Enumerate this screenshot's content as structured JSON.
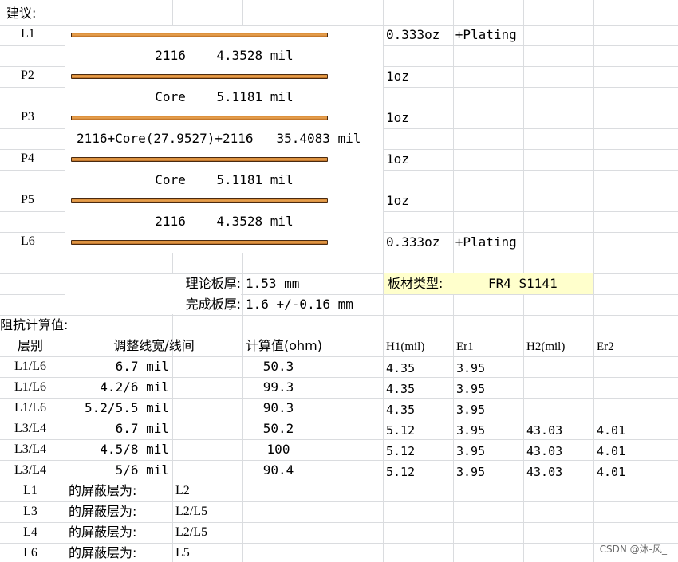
{
  "advice_title": "建议:",
  "stackup": [
    {
      "layer": "L1",
      "copper": "0.333oz  +Plating"
    },
    {
      "layer": "P2",
      "copper": "1oz"
    },
    {
      "layer": "P3",
      "copper": "1oz"
    },
    {
      "layer": "P4",
      "copper": "1oz"
    },
    {
      "layer": "P5",
      "copper": "1oz"
    },
    {
      "layer": "L6",
      "copper": "0.333oz  +Plating"
    }
  ],
  "dielectrics": [
    "2116    4.3528 mil",
    "Core    5.1181 mil",
    "2116+Core(27.9527)+2116   35.4083 mil",
    "Core    5.1181 mil",
    "2116    4.3528 mil"
  ],
  "thickness": {
    "theory_label": "理论板厚:",
    "theory_value": "1.53 mm",
    "finish_label": "完成板厚:",
    "finish_value": "1.6 +/-0.16 mm",
    "material_label": "板材类型:",
    "material_value": "FR4 S1141"
  },
  "impedance": {
    "title": "阻抗计算值:",
    "headers": {
      "layer": "层别",
      "width": "调整线宽/线间",
      "calc": "计算值(ohm)",
      "h1": "H1(mil)",
      "er1": "Er1",
      "h2": "H2(mil)",
      "er2": "Er2"
    },
    "rows": [
      {
        "layer": "L1/L6",
        "width": "6.7 mil",
        "calc": "50.3",
        "h1": "4.35",
        "er1": "3.95",
        "h2": "",
        "er2": ""
      },
      {
        "layer": "L1/L6",
        "width": "4.2/6 mil",
        "calc": "99.3",
        "h1": "4.35",
        "er1": "3.95",
        "h2": "",
        "er2": ""
      },
      {
        "layer": "L1/L6",
        "width": "5.2/5.5 mil",
        "calc": "90.3",
        "h1": "4.35",
        "er1": "3.95",
        "h2": "",
        "er2": ""
      },
      {
        "layer": "L3/L4",
        "width": "6.7 mil",
        "calc": "50.2",
        "h1": "5.12",
        "er1": "3.95",
        "h2": "43.03",
        "er2": "4.01"
      },
      {
        "layer": "L3/L4",
        "width": "4.5/8 mil",
        "calc": "100",
        "h1": "5.12",
        "er1": "3.95",
        "h2": "43.03",
        "er2": "4.01"
      },
      {
        "layer": "L3/L4",
        "width": "5/6 mil",
        "calc": "90.4",
        "h1": "5.12",
        "er1": "3.95",
        "h2": "43.03",
        "er2": "4.01"
      }
    ]
  },
  "shielding": [
    {
      "layer": "L1",
      "label": "的屏蔽层为:",
      "ref": "L2"
    },
    {
      "layer": "L3",
      "label": "的屏蔽层为:",
      "ref": "L2/L5"
    },
    {
      "layer": "L4",
      "label": "的屏蔽层为:",
      "ref": "L2/L5"
    },
    {
      "layer": "L6",
      "label": "的屏蔽层为:",
      "ref": "L5"
    }
  ],
  "watermark": "CSDN @沐-风_"
}
